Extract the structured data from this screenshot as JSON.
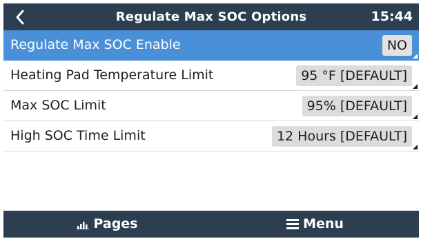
{
  "header": {
    "title": "Regulate Max SOC Options",
    "clock": "15:44",
    "back_icon": "chevron-left-icon"
  },
  "settings": [
    {
      "label": "Regulate Max SOC Enable",
      "value": "NO",
      "selected": true
    },
    {
      "label": "Heating Pad Temperature Limit",
      "value": "95 °F [DEFAULT]",
      "selected": false
    },
    {
      "label": "Max SOC Limit",
      "value": "95% [DEFAULT]",
      "selected": false
    },
    {
      "label": "High SOC Time Limit",
      "value": "12 Hours [DEFAULT]",
      "selected": false
    }
  ],
  "footer": {
    "pages_label": "Pages",
    "pages_icon": "bar-chart-icon",
    "menu_label": "Menu",
    "menu_icon": "hamburger-menu-icon"
  },
  "colors": {
    "header_bg": "#2c3e50",
    "selected_row": "#4a90d9",
    "value_box": "#dcdcdc"
  }
}
